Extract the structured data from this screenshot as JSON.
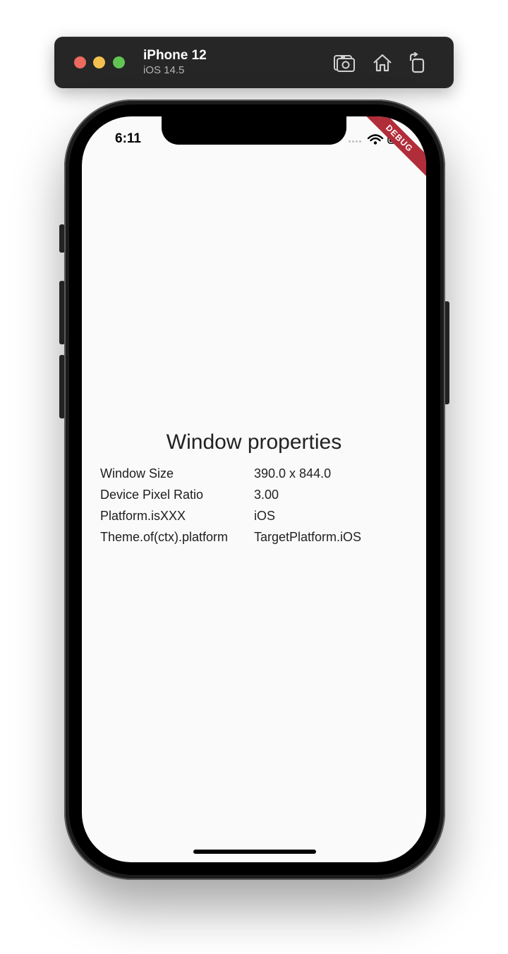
{
  "simulator": {
    "device_name": "iPhone 12",
    "os_version": "iOS 14.5",
    "icons": {
      "screenshot": "camera-icon",
      "home": "home-icon",
      "rotate": "rotate-icon"
    }
  },
  "status_bar": {
    "time": "6:11"
  },
  "debug_banner": "DEBUG",
  "content": {
    "title": "Window properties",
    "properties": [
      {
        "key": "Window Size",
        "value": "390.0 x 844.0"
      },
      {
        "key": "Device Pixel Ratio",
        "value": "3.00"
      },
      {
        "key": "Platform.isXXX",
        "value": "iOS"
      },
      {
        "key": "Theme.of(ctx).platform",
        "value": "TargetPlatform.iOS"
      }
    ]
  },
  "colors": {
    "toolbar_bg": "#262626",
    "traffic_red": "#ed6a5e",
    "traffic_yellow": "#f5bf4f",
    "traffic_green": "#61c554",
    "screen_bg": "#fafafa",
    "debug_banner": "#b22d3a"
  }
}
